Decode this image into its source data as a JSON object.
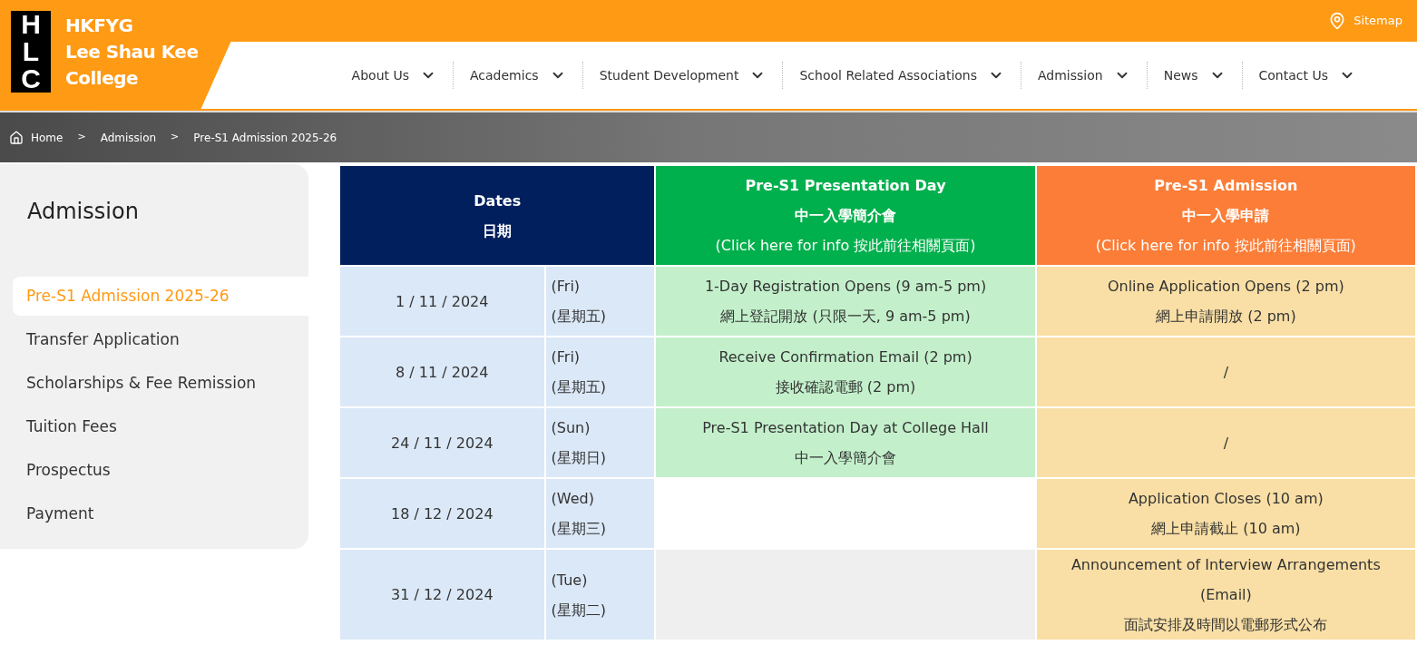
{
  "logo": {
    "letters": [
      "H",
      "L",
      "C"
    ],
    "name_lines": [
      "HKFYG",
      "Lee Shau Kee",
      "College"
    ]
  },
  "sitemap": "Sitemap",
  "nav": [
    "About Us",
    "Academics",
    "Student Development",
    "School Related Associations",
    "Admission",
    "News",
    "Contact Us"
  ],
  "breadcrumb": [
    "Home",
    "Admission",
    "Pre-S1 Admission 2025-26"
  ],
  "breadcrumb_separator": ">",
  "sidebar": {
    "title": "Admission",
    "items": [
      {
        "label": "Pre-S1 Admission 2025-26",
        "selected": true
      },
      {
        "label": "Transfer Application",
        "selected": false
      },
      {
        "label": "Scholarships & Fee Remission",
        "selected": false
      },
      {
        "label": "Tuition Fees",
        "selected": false
      },
      {
        "label": "Prospectus",
        "selected": false
      },
      {
        "label": "Payment",
        "selected": false
      }
    ]
  },
  "table": {
    "columns": [
      {
        "kind": "dates",
        "lines": [
          "Dates",
          "日期"
        ]
      },
      {
        "kind": "presentation",
        "lines": [
          "Pre-S1 Presentation Day",
          "中一入學簡介會",
          "(Click here for info 按此前往相關頁面)"
        ]
      },
      {
        "kind": "admission",
        "lines": [
          "Pre-S1 Admission",
          "中一入學申請",
          "(Click here for info 按此前往相關頁面)"
        ]
      }
    ],
    "rows": [
      {
        "date": "1 / 11 / 2024",
        "day": [
          "(Fri)",
          "(星期五)"
        ],
        "presentation": [
          "1-Day Registration Opens (9 am-5 pm)",
          "網上登記開放 (只限一天, 9 am-5 pm)"
        ],
        "admission": [
          "Online Application Opens (2 pm)",
          "網上申請開放 (2 pm)"
        ]
      },
      {
        "date": "8 / 11 / 2024",
        "day": [
          "(Fri)",
          "(星期五)"
        ],
        "presentation": [
          "Receive Confirmation Email (2 pm)",
          "接收確認電郵 (2 pm)"
        ],
        "admission": [
          "/"
        ]
      },
      {
        "date": "24 / 11 / 2024",
        "day": [
          "(Sun)",
          "(星期日)"
        ],
        "presentation": [
          "Pre-S1 Presentation Day at College Hall",
          "中一入學簡介會"
        ],
        "admission": [
          "/"
        ]
      },
      {
        "date": "18 / 12 / 2024",
        "day": [
          "(Wed)",
          "(星期三)"
        ],
        "admission": [
          "Application Closes (10 am)",
          "網上申請截止 (10 am)"
        ]
      },
      {
        "date": "31 / 12 / 2024",
        "day": [
          "(Tue)",
          "(星期二)"
        ],
        "admission": [
          "Announcement of Interview Arrangements",
          "(Email)",
          "面試安排及時間以電郵形式公布"
        ]
      }
    ]
  }
}
